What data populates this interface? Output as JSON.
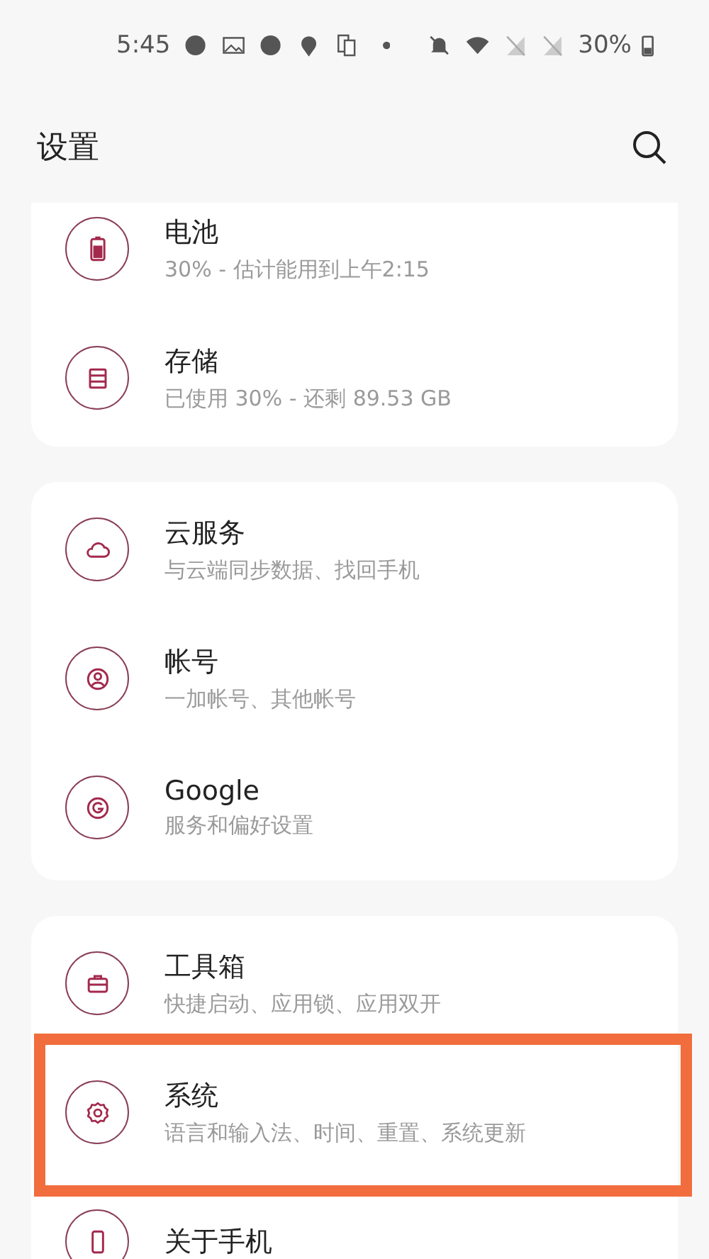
{
  "status_bar": {
    "time": "5:45",
    "battery": "30%"
  },
  "header": {
    "title": "设置"
  },
  "groups": [
    {
      "items": [
        {
          "kind": "battery",
          "title": "电池",
          "subtitle": "30% - 估计能用到上午2:15",
          "highlighted": false
        },
        {
          "kind": "storage",
          "title": "存储",
          "subtitle": "已使用 30% - 还剩 89.53 GB",
          "highlighted": false
        }
      ]
    },
    {
      "items": [
        {
          "kind": "cloud",
          "title": "云服务",
          "subtitle": "与云端同步数据、找回手机",
          "highlighted": false
        },
        {
          "kind": "account",
          "title": "帐号",
          "subtitle": "一加帐号、其他帐号",
          "highlighted": false
        },
        {
          "kind": "google",
          "title": "Google",
          "subtitle": "服务和偏好设置",
          "highlighted": false
        }
      ]
    },
    {
      "items": [
        {
          "kind": "toolbox",
          "title": "工具箱",
          "subtitle": "快捷启动、应用锁、应用双开",
          "highlighted": false
        },
        {
          "kind": "gear",
          "title": "系统",
          "subtitle": "语言和输入法、时间、重置、系统更新",
          "highlighted": true
        },
        {
          "kind": "phone",
          "title": "关于手机",
          "highlighted": false
        }
      ]
    }
  ]
}
